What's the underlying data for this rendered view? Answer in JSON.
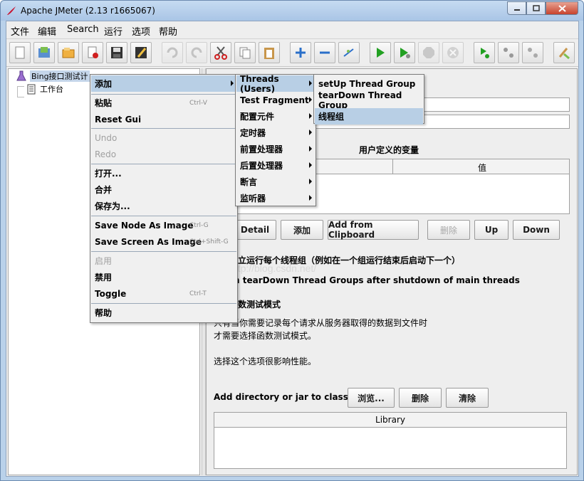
{
  "window": {
    "title": "Apache JMeter (2.13 r1665067)"
  },
  "menubar": [
    "文件",
    "编辑",
    "Search",
    "运行",
    "选项",
    "帮助"
  ],
  "toolbar": {
    "icons": [
      "new-icon",
      "templates-icon",
      "open-icon",
      "close-icon",
      "save-icon",
      "save-as-icon",
      "undo-icon",
      "redo-icon",
      "cut-icon",
      "copy-icon",
      "paste-icon",
      "expand-icon",
      "collapse-icon",
      "toggle-icon",
      "start-icon",
      "start-no-pause-icon",
      "stop-icon",
      "shutdown-icon",
      "remote-start-icon",
      "remote-stop-icon",
      "remote-shutdown-icon",
      "clear-all-icon"
    ]
  },
  "tree": {
    "root": "Bing接口测试计",
    "workbench": "工作台"
  },
  "context_menu": {
    "add": "添加",
    "paste": "粘贴",
    "paste_acc": "Ctrl-V",
    "reset_gui": "Reset Gui",
    "undo": "Undo",
    "redo": "Redo",
    "open": "打开...",
    "merge": "合并",
    "save_as": "保存为...",
    "save_node_image": "Save Node As Image",
    "save_node_image_acc": "Ctrl-G",
    "save_screen_image": "Save Screen As Image",
    "save_screen_image_acc": "Ctrl+Shift-G",
    "enable": "启用",
    "disable": "禁用",
    "toggle": "Toggle",
    "toggle_acc": "Ctrl-T",
    "help": "帮助"
  },
  "add_submenu": [
    "Threads (Users)",
    "Test Fragment",
    "配置元件",
    "定时器",
    "前置处理器",
    "后置处理器",
    "断言",
    "监听器"
  ],
  "threads_submenu": [
    "setUp Thread Group",
    "tearDown Thread Group",
    "线程组"
  ],
  "right": {
    "vars_title": "用户定义的变量",
    "col_value": "值",
    "btn_detail": "Detail",
    "btn_add": "添加",
    "btn_add_clipboard": "Add from Clipboard",
    "btn_delete": "删除",
    "btn_up": "Up",
    "btn_down": "Down",
    "opt_serialize": "立运行每个线程组（例如在一个组运行结束后启动下一个）",
    "opt_teardown": "n tearDown Thread Groups after shutdown of main threads",
    "opt_functional": "数测试模式",
    "desc1": "只有当你需要记录每个请求从服务器取得的数据到文件时",
    "desc2": "才需要选择函数测试模式。",
    "desc3": "选择这个选项很影响性能。",
    "classpath_label": "Add directory or jar to classpath",
    "btn_browse": "浏览...",
    "btn_cp_delete": "删除",
    "btn_clear": "清除",
    "library_header": "Library"
  },
  "watermark": "http://blog.csdn.net/"
}
